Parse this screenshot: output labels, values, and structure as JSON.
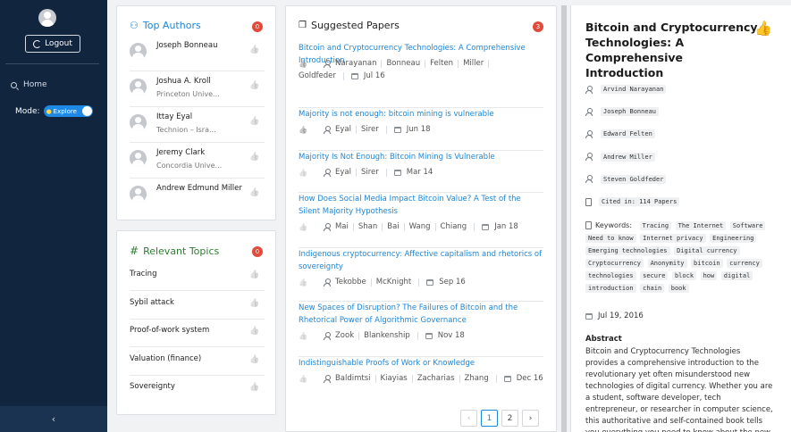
{
  "sidebar": {
    "logout_label": "Logout",
    "home_label": "Home",
    "mode_label": "Mode:",
    "mode_value": "Explore",
    "collapse_glyph": "‹"
  },
  "authors": {
    "title": "Top Authors",
    "badge": "0",
    "items": [
      {
        "name": "Joseph Bonneau",
        "affiliation": ""
      },
      {
        "name": "Joshua A. Kroll",
        "affiliation": "Princeton Unive..."
      },
      {
        "name": "Ittay Eyal",
        "affiliation": "Technion – Isra..."
      },
      {
        "name": "Jeremy Clark",
        "affiliation": "Concordia Unive..."
      },
      {
        "name": "Andrew Edmund Miller",
        "affiliation": ""
      }
    ]
  },
  "topics": {
    "title": "Relevant Topics",
    "badge": "0",
    "items": [
      "Tracing",
      "Sybil attack",
      "Proof-of-work system",
      "Valuation (finance)",
      "Sovereignty"
    ]
  },
  "papers": {
    "title": "Suggested Papers",
    "badge": "3",
    "items": [
      {
        "title": "Bitcoin and Cryptocurrency Technologies: A Comprehensive Introduction",
        "authors": [
          "Narayanan",
          "Bonneau",
          "Felten",
          "Miller",
          "Goldfeder"
        ],
        "date": "Jul 16",
        "liked": true
      },
      {
        "title": "Majority is not enough: bitcoin mining is vulnerable",
        "authors": [
          "Eyal",
          "Sirer"
        ],
        "date": "Jun 18",
        "liked": true
      },
      {
        "title": "Majority Is Not Enough: Bitcoin Mining Is Vulnerable",
        "authors": [
          "Eyal",
          "Sirer"
        ],
        "date": "Mar 14",
        "liked": false
      },
      {
        "title": "How Does Social Media Impact Bitcoin Value? A Test of the Silent Majority Hypothesis",
        "authors": [
          "Mai",
          "Shan",
          "Bai",
          "Wang",
          "Chiang"
        ],
        "date": "Jan 18",
        "liked": false
      },
      {
        "title": "Indigenous cryptocurrency: Affective capitalism and rhetorics of sovereignty",
        "authors": [
          "Tekobbe",
          "McKnight"
        ],
        "date": "Sep 16",
        "liked": false
      },
      {
        "title": "New Spaces of Disruption? The Failures of Bitcoin and the Rhetorical Power of Algorithmic Governance",
        "authors": [
          "Zook",
          "Blankenship"
        ],
        "date": "Nov 18",
        "liked": false
      },
      {
        "title": "Indistinguishable Proofs of Work or Knowledge",
        "authors": [
          "Baldimtsi",
          "Kiayias",
          "Zacharias",
          "Zhang"
        ],
        "date": "Dec 16",
        "liked": false
      }
    ],
    "pagination": {
      "prev": "‹",
      "pages": [
        "1",
        "2"
      ],
      "next": "›"
    }
  },
  "detail": {
    "title": "Bitcoin and Cryptocurrency Technologies: A Comprehensive Introduction",
    "authors": [
      "Arvind Narayanan",
      "Joseph Bonneau",
      "Edward Felten",
      "Andrew Miller",
      "Steven Goldfeder"
    ],
    "cited": "Cited in: 114 Papers",
    "keywords_label": "Keywords:",
    "keywords": [
      "Tracing",
      "The Internet",
      "Software",
      "Need to know",
      "Internet privacy",
      "Engineering",
      "Emerging technologies",
      "Digital currency",
      "Cryptocurrency",
      "Anonymity",
      "bitcoin",
      "currency",
      "technologies",
      "secure",
      "block",
      "how",
      "digital",
      "introduction",
      "chain",
      "book"
    ],
    "date": "Jul 19, 2016",
    "abstract_label": "Abstract",
    "abstract": "Bitcoin and Cryptocurrency Technologies provides a comprehensive introduction to the revolutionary yet often misunderstood new technologies of digital currency. Whether you are a student, software developer, tech entrepreneur, or researcher in computer science, this authoritative and self-contained book tells you everything you need to know about the new global money for the"
  },
  "colors": {
    "accent": "#1f85d6",
    "sidebar": "#11253f",
    "badge": "#e04b3c",
    "topics_accent": "#2e7d32"
  }
}
